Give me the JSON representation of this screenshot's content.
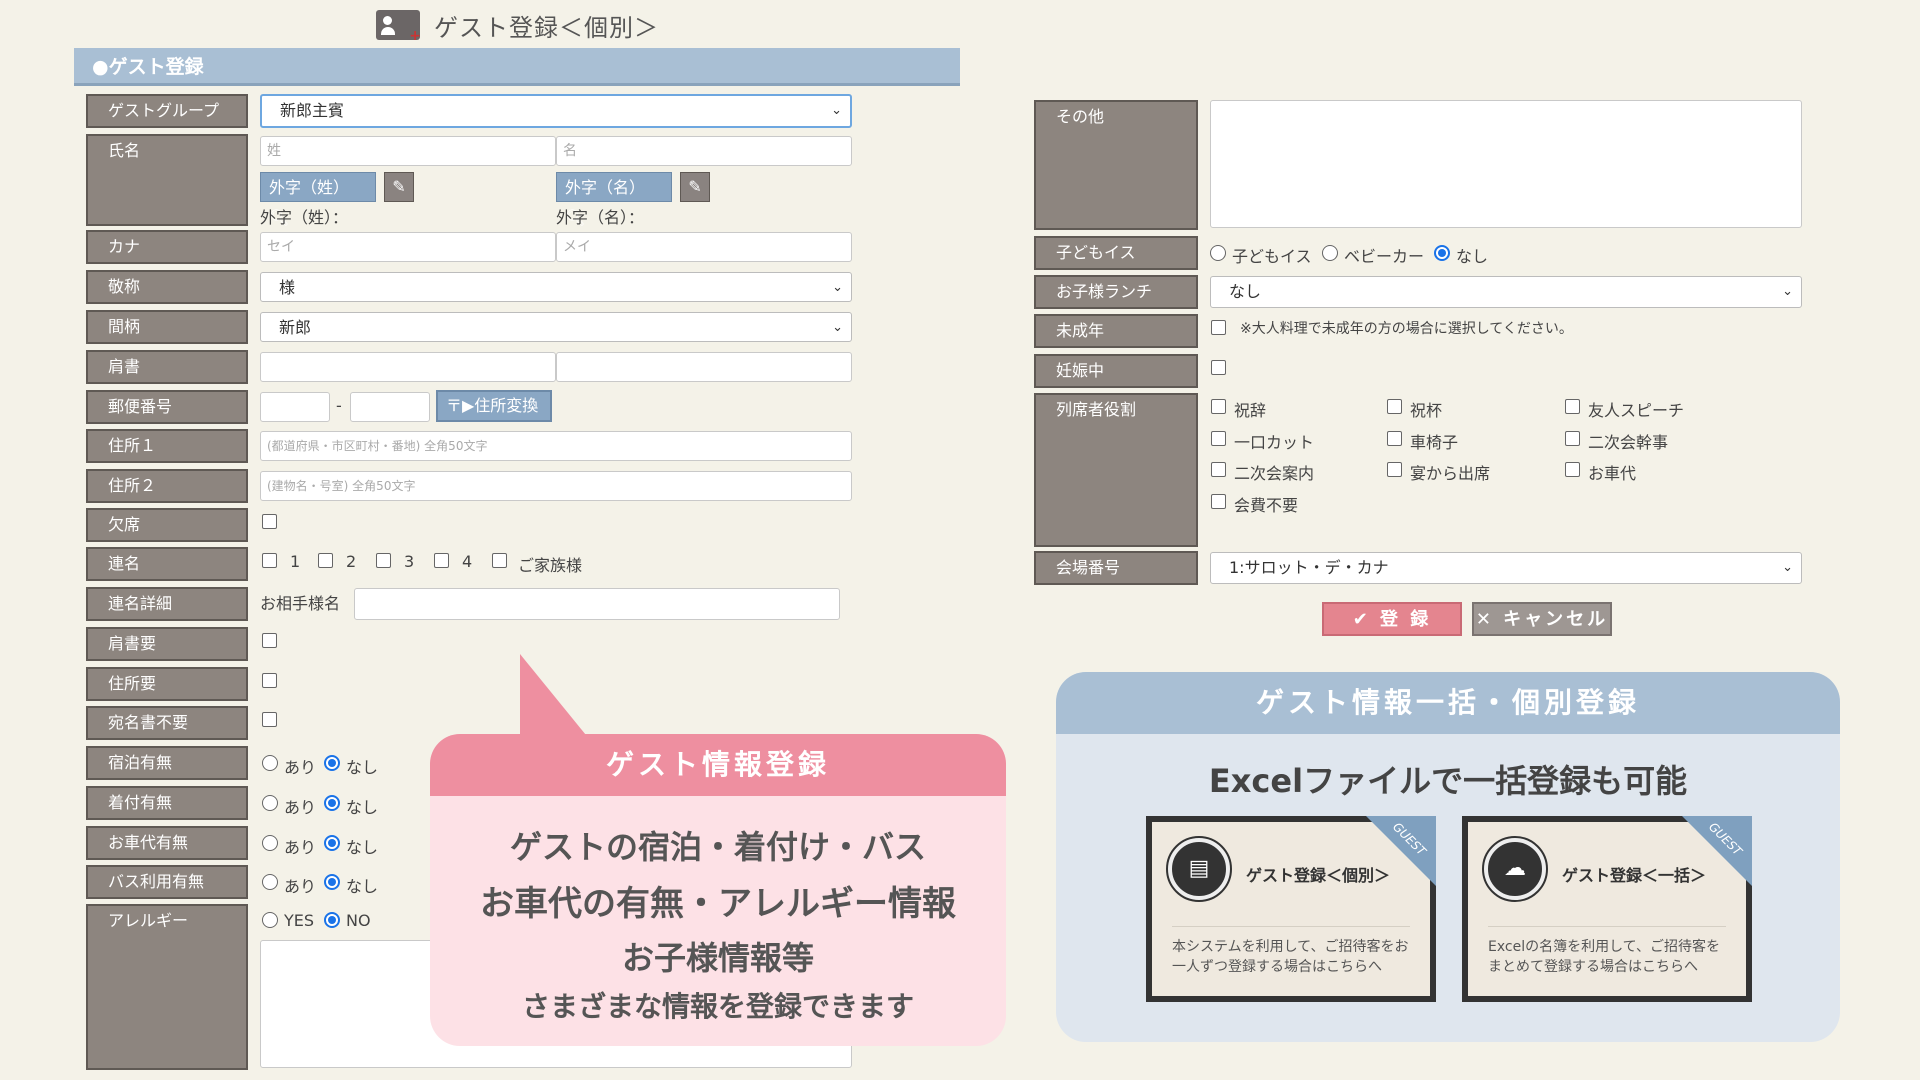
{
  "title": "ゲスト登録＜個別＞",
  "section_title": "●ゲスト登録",
  "left": {
    "labels": {
      "group": "ゲストグループ",
      "name": "氏名",
      "kana": "カナ",
      "honorific": "敬称",
      "relation": "間柄",
      "title": "肩書",
      "zip": "郵便番号",
      "addr1": "住所１",
      "addr2": "住所２",
      "absence": "欠席",
      "joint": "連名",
      "joint_detail": "連名詳細",
      "title_needed": "肩書要",
      "addr_needed": "住所要",
      "no_addressee": "宛名書不要",
      "lodging": "宿泊有無",
      "dressing": "着付有無",
      "car_fee": "お車代有無",
      "bus": "バス利用有無",
      "allergy": "アレルギー"
    },
    "group_value": "新郎主賓",
    "sei_placeholder": "姓",
    "mei_placeholder": "名",
    "gaiji_sei_btn": "外字（姓）",
    "gaiji_mei_btn": "外字（名）",
    "gaiji_sei_label": "外字（姓）：",
    "gaiji_mei_label": "外字（名）：",
    "kana_sei_placeholder": "セイ",
    "kana_mei_placeholder": "メイ",
    "honorific_value": "様",
    "relation_value": "新郎",
    "zip_dash": "-",
    "zip_btn": "〒▶住所変換",
    "addr1_placeholder": "(都道府県・市区町村・番地) 全角50文字",
    "addr2_placeholder": "(建物名・号室) 全角50文字",
    "joint_options": [
      "1",
      "2",
      "3",
      "4",
      "ご家族様"
    ],
    "partner_label": "お相手様名",
    "yes_no": {
      "ari": "あり",
      "nashi": "なし"
    },
    "allergy_yes": "YES",
    "allergy_no": "NO"
  },
  "right": {
    "labels": {
      "other": "その他",
      "child_chair": "子どもイス",
      "kids_lunch": "お子様ランチ",
      "minor": "未成年",
      "pregnant": "妊娠中",
      "role": "列席者役割",
      "venue": "会場番号"
    },
    "child_chair_options": [
      "子どもイス",
      "ベビーカー",
      "なし"
    ],
    "kids_lunch_value": "なし",
    "minor_note": "※大人料理で未成年の方の場合に選択してください。",
    "roles": [
      "祝辞",
      "祝杯",
      "友人スピーチ",
      "一口カット",
      "車椅子",
      "二次会幹事",
      "二次会案内",
      "宴から出席",
      "お車代",
      "会費不要"
    ],
    "venue_value": "1:サロット・デ・カナ",
    "register_btn": "✔ 登 録",
    "cancel_btn": "✕ キャンセル"
  },
  "promo_pink": {
    "head": "ゲスト情報登録",
    "line1": "ゲストの宿泊・着付け・バス",
    "line2": "お車代の有無・アレルギー情報",
    "line3": "お子様情報等",
    "line4": "さまざまな情報を登録できます"
  },
  "promo_blue": {
    "head": "ゲスト情報一括・個別登録",
    "sub": "Excelファイルで一括登録も可能",
    "card1_title": "ゲスト登録＜個別＞",
    "card1_desc": "本システムを利用して、ご招待客をお一人ずつ登録する場合はこちらへ",
    "card2_title": "ゲスト登録＜一括＞",
    "card2_desc": "Excelの名簿を利用して、ご招待客をまとめて登録する場合はこちらへ",
    "ribbon": "GUEST"
  }
}
